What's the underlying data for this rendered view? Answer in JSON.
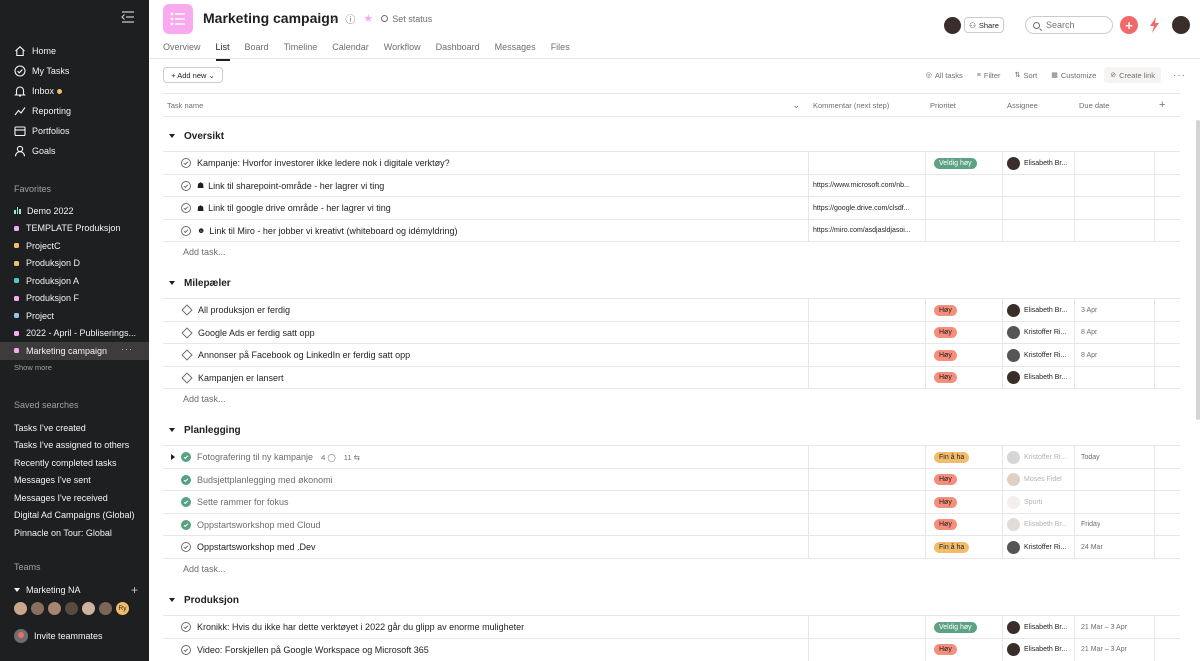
{
  "sidebar": {
    "nav": [
      {
        "label": "Home",
        "icon": "home-icon"
      },
      {
        "label": "My Tasks",
        "icon": "check-circle-icon"
      },
      {
        "label": "Inbox",
        "icon": "bell-icon"
      },
      {
        "label": "Reporting",
        "icon": "chart-line-icon"
      },
      {
        "label": "Portfolios",
        "icon": "folder-icon"
      },
      {
        "label": "Goals",
        "icon": "person-icon"
      }
    ],
    "favorites_title": "Favorites",
    "favorites": [
      {
        "label": "Demo 2022",
        "color": "#9ee7e3"
      },
      {
        "label": "TEMPLATE Produksjon",
        "color": "#f9aaef"
      },
      {
        "label": "ProjectC",
        "color": "#f1bd6c"
      },
      {
        "label": "Produksjon D",
        "color": "#f1bd6c"
      },
      {
        "label": "Produksjon A",
        "color": "#4ecbc4"
      },
      {
        "label": "Produksjon F",
        "color": "#f9aaef"
      },
      {
        "label": "Project",
        "color": "#9ac0f5"
      },
      {
        "label": "2022 - April - Publiserings...",
        "color": "#f9aaef"
      },
      {
        "label": "Marketing campaign",
        "color": "#f9aaef",
        "more": "···"
      }
    ],
    "show_more": "Show more",
    "saved_title": "Saved searches",
    "saved": [
      "Tasks I've created",
      "Tasks I've assigned to others",
      "Recently completed tasks",
      "Messages I've sent",
      "Messages I've received",
      "Digital Ad Campaigns (Global)",
      "Pinnacle on Tour: Global"
    ],
    "teams_title": "Teams",
    "team_name": "Marketing NA",
    "team_plus": "+",
    "team_avatar_initials": "Ry",
    "invite": "Invite teammates"
  },
  "header": {
    "title": "Marketing campaign",
    "set_status": "Set status",
    "share": "Share",
    "search_placeholder": "Search",
    "plus": "+",
    "tabs": [
      "Overview",
      "List",
      "Board",
      "Timeline",
      "Calendar",
      "Workflow",
      "Dashboard",
      "Messages",
      "Files"
    ]
  },
  "toolbar": {
    "add_new": "+ Add new ⌄",
    "all_tasks": "All tasks",
    "filter": "Filter",
    "sort": "Sort",
    "customize": "Customize",
    "create_link": "Create link",
    "more": "···"
  },
  "columns": {
    "task": "Task name",
    "comment": "Kommentar (next step)",
    "priority": "Prioritet",
    "assignee": "Assignee",
    "due": "Due date",
    "add": "+"
  },
  "add_task": "Add task...",
  "sections": [
    {
      "name": "Oversikt",
      "rows": [
        {
          "task": "Kampanje: Hvorfor investorer ikke ledere nok i digitale verktøy?",
          "type": "check",
          "priority": "Veldig høy",
          "pclass": "p-vh",
          "assignee": "Elisabeth Br...",
          "avatar": "#3a2e2a"
        },
        {
          "task": "Link til sharepoint-område - her lagrer vi ting",
          "type": "check",
          "emoji": "☗",
          "comment": "https://www.microsoft.com/nb..."
        },
        {
          "task": "Link til google drive område - her lagrer vi ting",
          "type": "check",
          "emoji": "☗",
          "comment": "https://google.drive.com/clsdf..."
        },
        {
          "task": "Link til Miro - her jobber vi kreativt (whiteboard og idémyldring)",
          "type": "check",
          "emoji": "☻",
          "comment": "https://miro.com/asdjasldjasoi..."
        }
      ]
    },
    {
      "name": "Milepæler",
      "rows": [
        {
          "task": "All produksjon er ferdig",
          "type": "milestone",
          "priority": "Høy",
          "pclass": "p-h",
          "assignee": "Elisabeth Br...",
          "avatar": "#3a2e2a",
          "due": "3 Apr"
        },
        {
          "task": "Google Ads er ferdig satt opp",
          "type": "milestone",
          "priority": "Høy",
          "pclass": "p-h",
          "assignee": "Kristoffer Ri...",
          "avatar": "#555555",
          "due": "8 Apr"
        },
        {
          "task": "Annonser på Facebook og LinkedIn er ferdig satt opp",
          "type": "milestone",
          "priority": "Høy",
          "pclass": "p-h",
          "assignee": "Kristoffer Ri...",
          "avatar": "#555555",
          "due": "8 Apr"
        },
        {
          "task": "Kampanjen er lansert",
          "type": "milestone",
          "priority": "Høy",
          "pclass": "p-h",
          "assignee": "Elisabeth Br...",
          "avatar": "#3a2e2a"
        }
      ]
    },
    {
      "name": "Planlegging",
      "rows": [
        {
          "task": "Fotografering til ny kampanje",
          "type": "done",
          "expand": true,
          "comments": "4 ◯",
          "subtasks": "11 ⇆",
          "priority": "Fin å ha",
          "pclass": "p-f",
          "assignee": "Kristoffer Ri...",
          "avatar": "#999999",
          "faded": true,
          "due": "Today"
        },
        {
          "task": "Budsjettplanlegging med økonomi",
          "type": "done",
          "priority": "Høy",
          "pclass": "p-h",
          "assignee": "Moses Fidel",
          "avatar": "#b08a70",
          "faded": true
        },
        {
          "task": "Sette rammer for fokus",
          "type": "done",
          "priority": "Høy",
          "pclass": "p-h",
          "assignee": "Spurti",
          "avatar": "#e0d8d0",
          "faded": true
        },
        {
          "task": "Oppstartsworkshop med Cloud",
          "type": "done",
          "priority": "Høy",
          "pclass": "p-h",
          "assignee": "Elisabeth Br...",
          "avatar": "#b5a79f",
          "faded": true,
          "due": "Friday"
        },
        {
          "task": "Oppstartsworkshop med .Dev",
          "type": "check",
          "priority": "Fin å ha",
          "pclass": "p-f",
          "assignee": "Kristoffer Ri...",
          "avatar": "#555555",
          "due": "24 Mar"
        }
      ]
    },
    {
      "name": "Produksjon",
      "rows": [
        {
          "task": "Kronikk: Hvis du ikke har dette verktøyet i 2022 går du glipp av enorme muligheter",
          "type": "check",
          "priority": "Veldig høy",
          "pclass": "p-vh",
          "assignee": "Elisabeth Br...",
          "avatar": "#3a2e2a",
          "due": "21 Mar – 3 Apr"
        },
        {
          "task": "Video: Forskjellen på Google Workspace og Microsoft 365",
          "type": "check",
          "priority": "Høy",
          "pclass": "p-h",
          "assignee": "Elisabeth Br...",
          "avatar": "#3a2e2a",
          "due": "21 Mar – 3 Apr"
        }
      ]
    }
  ]
}
